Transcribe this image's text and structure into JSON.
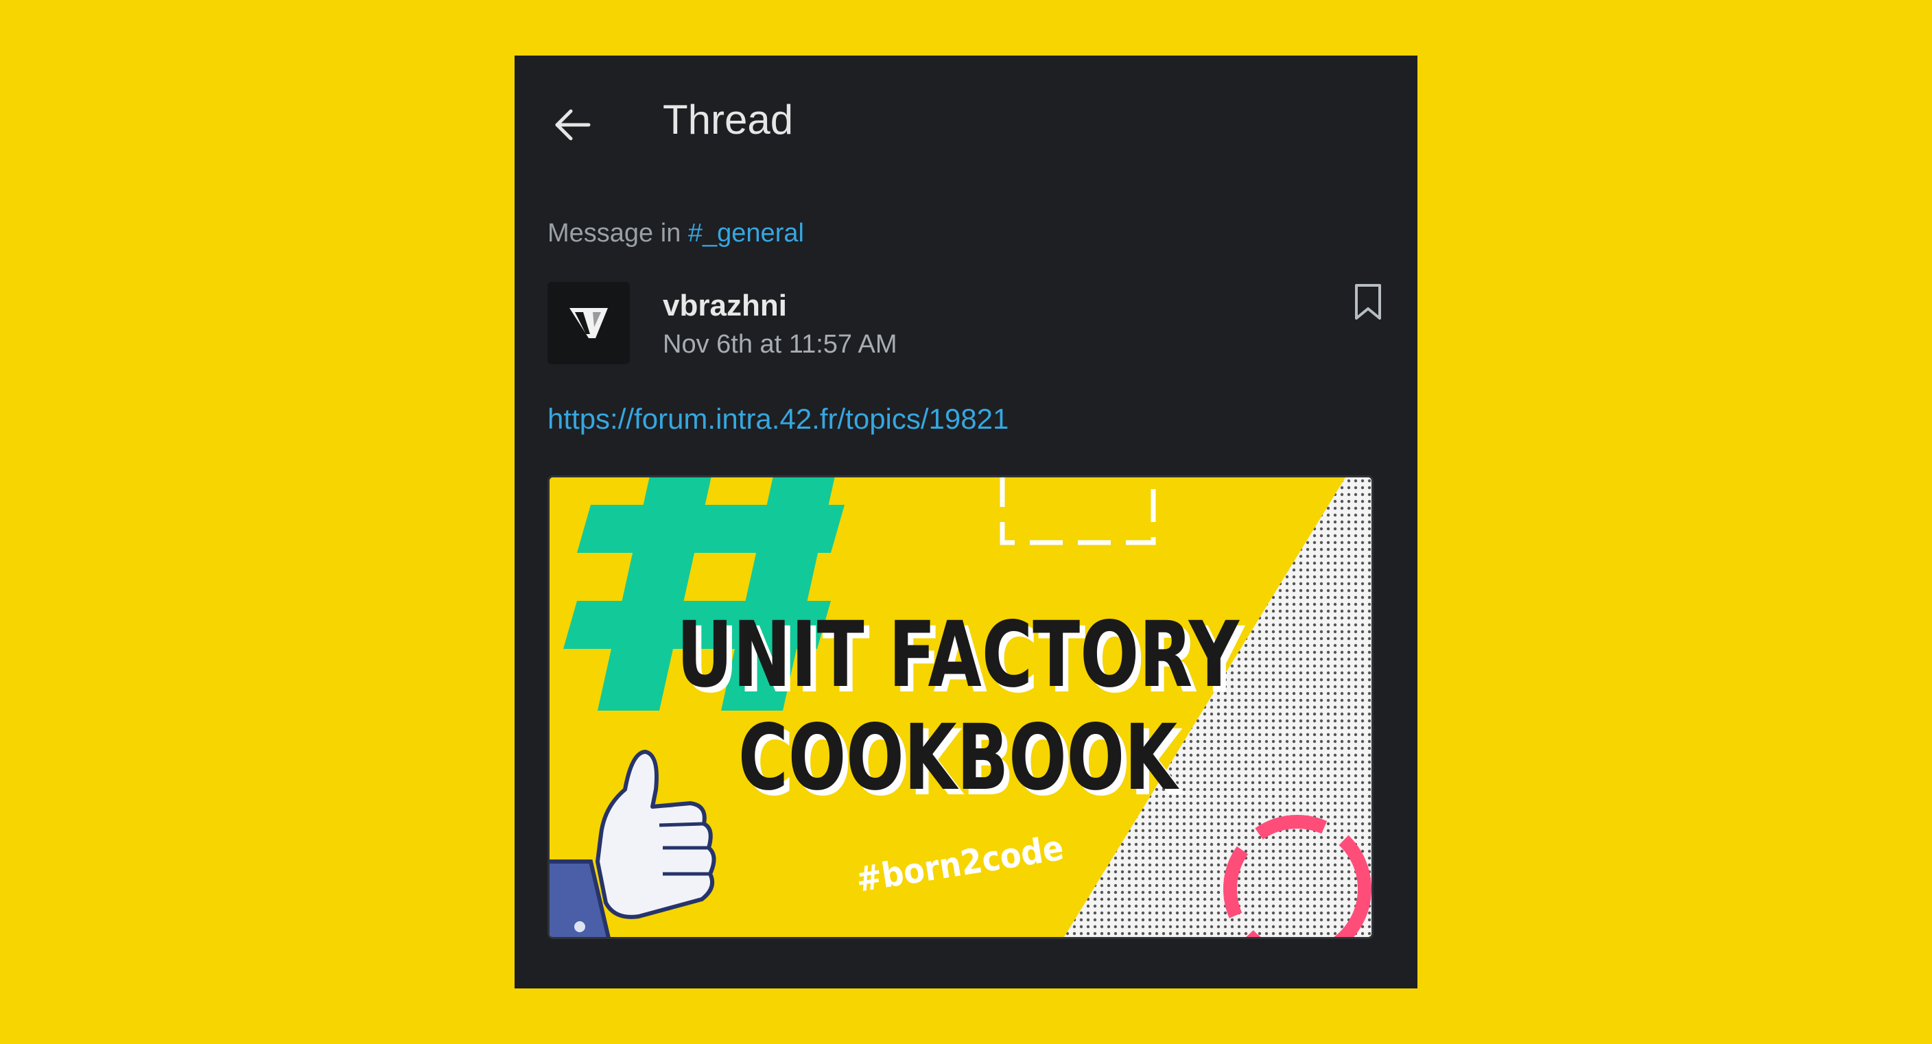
{
  "header": {
    "title": "Thread",
    "back_icon": "arrow-left-icon"
  },
  "context": {
    "prefix": "Message in",
    "channel": "#_general"
  },
  "message": {
    "author": "vbrazhni",
    "timestamp": "Nov 6th at 11:57 AM",
    "link": "https://forum.intra.42.fr/topics/19821",
    "bookmark_icon": "bookmark-icon"
  },
  "preview": {
    "line1": "UNIT FACTORY",
    "line2": "COOKBOOK",
    "tag": "#born2code",
    "hash_glyph": "#"
  },
  "colors": {
    "background": "#F6D500",
    "panel": "#1D1F23",
    "link": "#36A7E0",
    "accent_green": "#12C99A",
    "accent_pink": "#FF4D7A"
  }
}
